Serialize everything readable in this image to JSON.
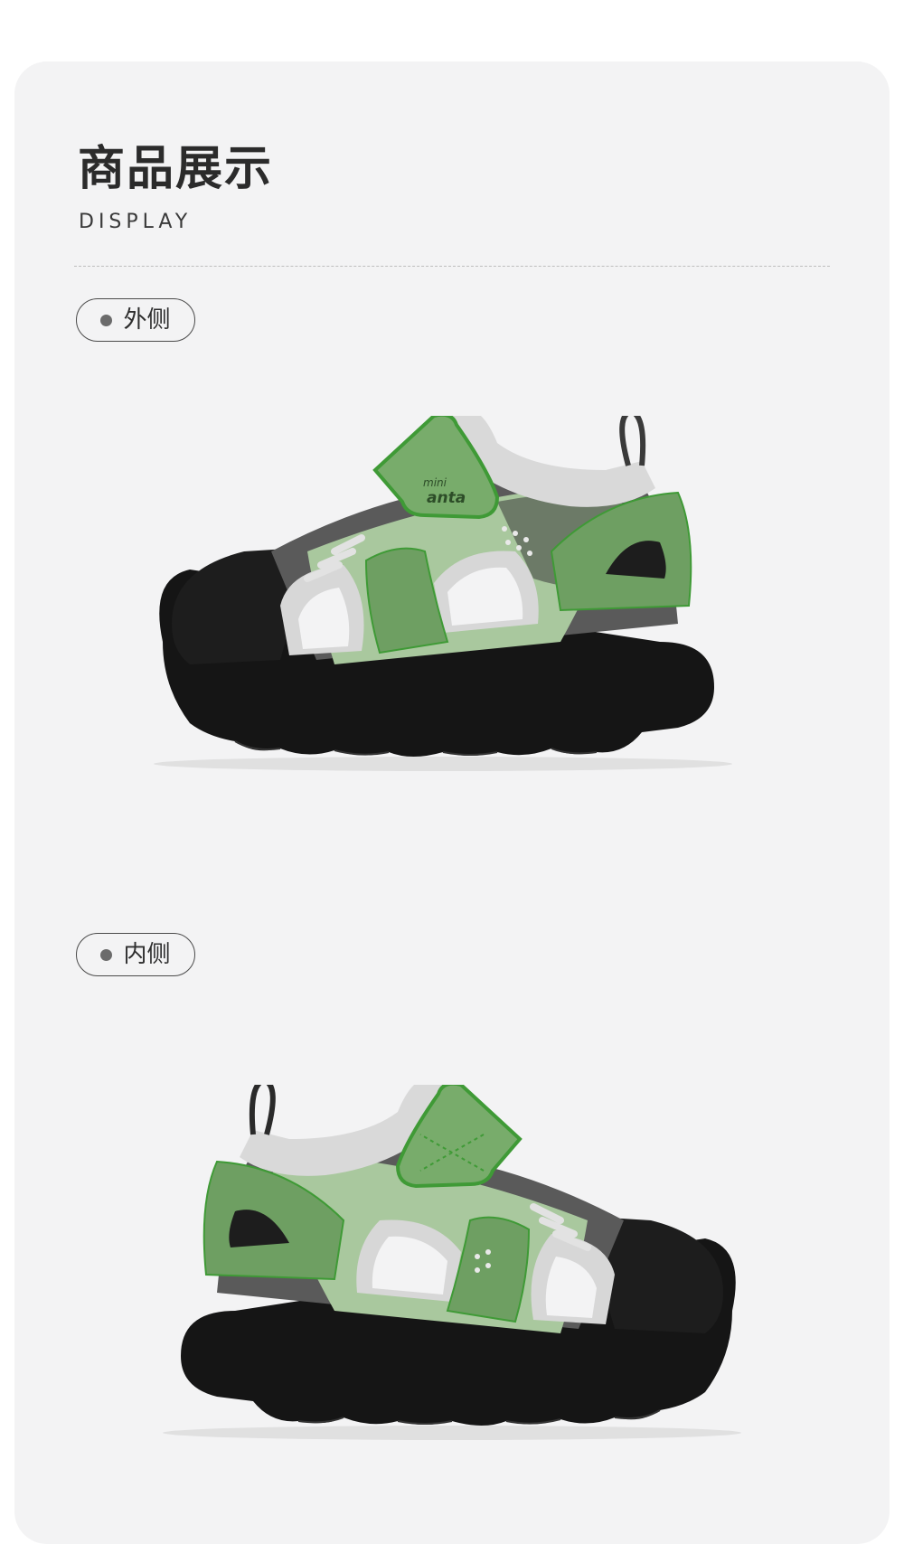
{
  "header": {
    "title": "商品展示",
    "subtitle": "DISPLAY"
  },
  "views": [
    {
      "label": "外侧",
      "image": "shoe-outer-side"
    },
    {
      "label": "内侧",
      "image": "shoe-inner-side"
    }
  ],
  "shoe": {
    "brand_mark_top": "mini",
    "brand_mark_bottom": "anta",
    "colors": {
      "upper_green": "#6e9f62",
      "light_green": "#a9c89e",
      "outline_green": "#3f9a36",
      "sole_black": "#151515",
      "mesh_gray": "#d9d9d9"
    }
  },
  "theme": {
    "card_background": "#f3f3f4",
    "page_background": "#ffffff",
    "text_dark": "#2b2b2b"
  }
}
